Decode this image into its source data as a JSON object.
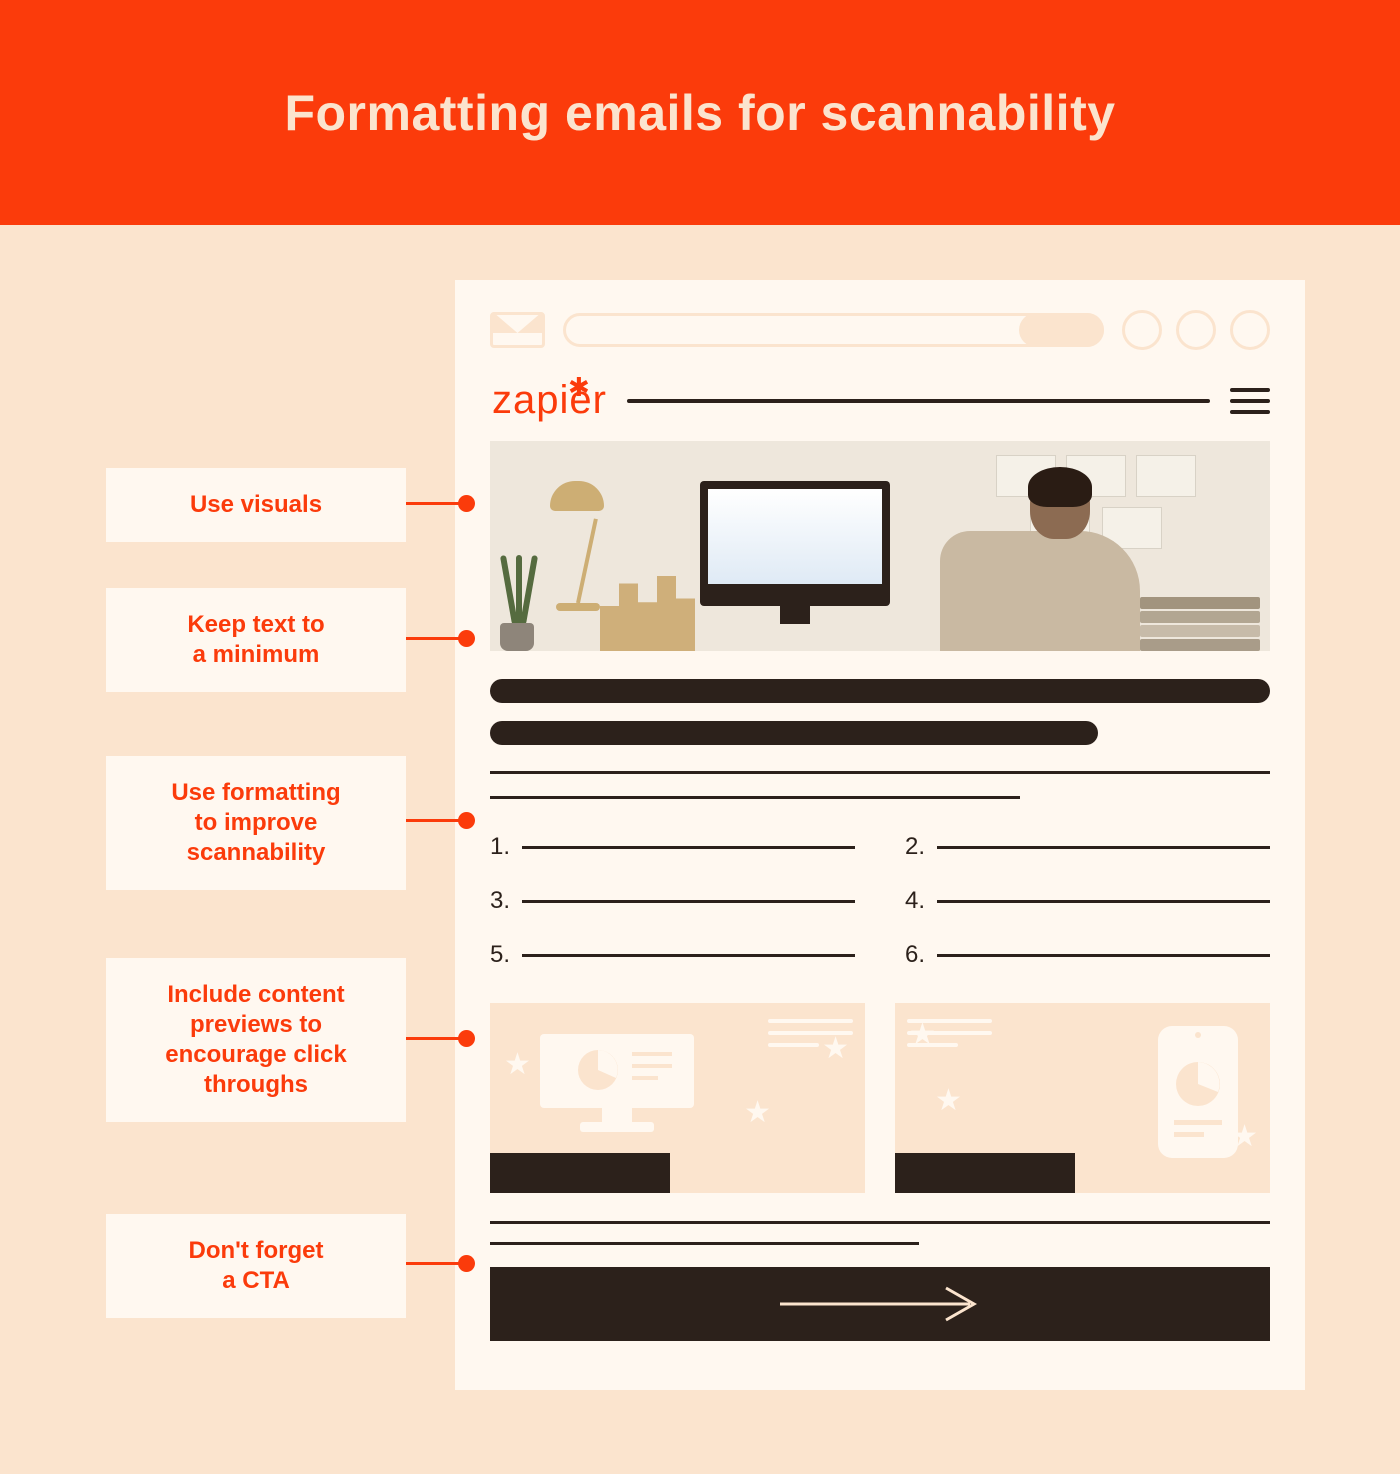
{
  "header": {
    "title": "Formatting emails for scannability"
  },
  "brand": {
    "name": "zapier"
  },
  "labels": {
    "l1": "Use visuals",
    "l2": "Keep text to\na minimum",
    "l3": "Use formatting\nto improve\nscannability",
    "l4": "Include content\npreviews to\nencourage click\nthroughs",
    "l5": "Don't forget\na CTA"
  },
  "list_numbers": [
    "1.",
    "2.",
    "3.",
    "4.",
    "5.",
    "6."
  ]
}
